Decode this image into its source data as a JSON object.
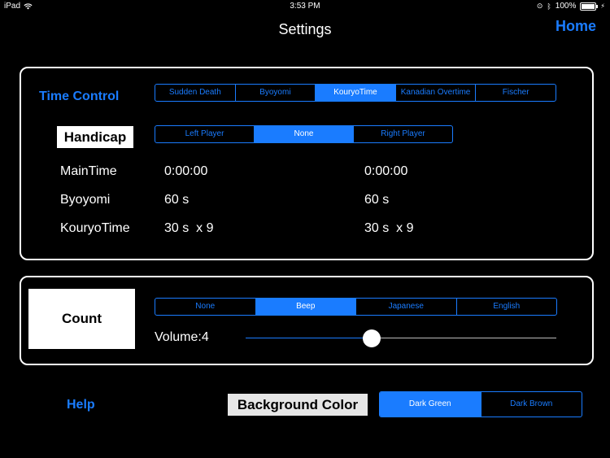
{
  "status_bar": {
    "device": "iPad",
    "time": "3:53 PM",
    "battery": "100%"
  },
  "nav": {
    "title": "Settings",
    "home_label": "Home"
  },
  "time_control": {
    "label": "Time Control",
    "options": [
      "Sudden Death",
      "Byoyomi",
      "KouryoTime",
      "Kanadian Overtime",
      "Fischer"
    ],
    "selected": "KouryoTime"
  },
  "handicap": {
    "label": "Handicap",
    "options": [
      "Left Player",
      "None",
      "Right Player"
    ],
    "selected": "None"
  },
  "rows": [
    {
      "label": "MainTime",
      "left": "0:00:00",
      "right": "0:00:00"
    },
    {
      "label": "Byoyomi",
      "left": "60 s",
      "right": "60 s"
    },
    {
      "label": "KouryoTime",
      "left": "30 s  x 9",
      "right": "30 s  x 9"
    }
  ],
  "count": {
    "label": "Count",
    "options": [
      "None",
      "Beep",
      "Japanese",
      "English"
    ],
    "selected": "Beep",
    "volume_label": "Volume:4",
    "volume_level": 0.4
  },
  "help_label": "Help",
  "background": {
    "label": "Background Color",
    "options": [
      "Dark Green",
      "Dark Brown"
    ],
    "selected": "Dark Green"
  },
  "colors": {
    "accent": "#1a7cff",
    "background": "#000000",
    "text": "#ffffff"
  }
}
